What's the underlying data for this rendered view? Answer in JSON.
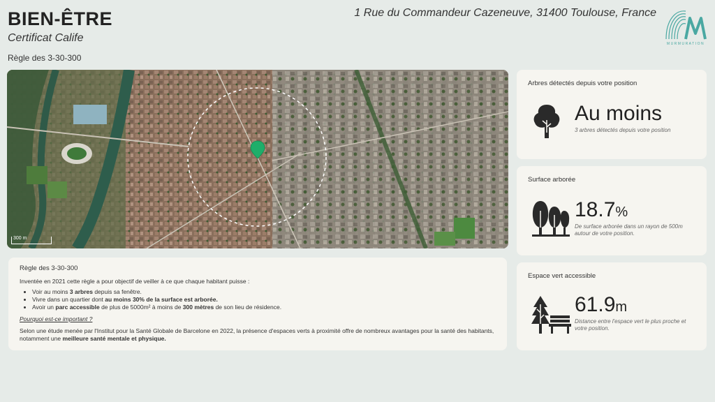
{
  "header": {
    "title": "BIEN-ÊTRE",
    "subtitle": "Certificat Calife",
    "section_label": "Règle des 3-30-300",
    "address": "1 Rue du Commandeur Cazeneuve, 31400 Toulouse, France",
    "logo_text": "MURMURATION"
  },
  "map": {
    "scale_label": "300 m",
    "accent_color": "#1fae6a"
  },
  "info": {
    "heading": "Règle des 3-30-300",
    "intro": "Inventée en 2021 cette règle a pour objectif de veiller à ce que chaque habitant puisse :",
    "bullets": [
      {
        "pre": "Voir au moins ",
        "bold": "3 arbres",
        "post": " depuis sa fenêtre.",
        "bold2": "",
        "post2": ""
      },
      {
        "pre": "Vivre dans un quartier dont ",
        "bold": "au moins 30% de la surface est arborée.",
        "post": "",
        "bold2": "",
        "post2": ""
      },
      {
        "pre": "Avoir un ",
        "bold": "parc accessible",
        "post": " de plus de 5000m² à moins de ",
        "bold2": "300 mètres",
        "post2": " de son lieu de résidence."
      }
    ],
    "why": "Pourquoi est-ce important ?",
    "conclusion_pre": "Selon une étude menée par l'Institut pour la Santé Globale de Barcelone en 2022, la présence d'espaces verts à proximité offre de nombreux avantages pour la santé des habitants, notamment une ",
    "conclusion_bold": "meilleure santé mentale et physique."
  },
  "cards": [
    {
      "label": "Arbres détectés depuis votre position",
      "value": "Au moins",
      "unit": "",
      "desc": "3 arbres détectés depuis votre position",
      "icon": "tree-icon"
    },
    {
      "label": "Surface arborée",
      "value": "18.7",
      "unit": "%",
      "desc": "De surface arborée dans un rayon de 500m autour de votre position.",
      "icon": "trees-icon"
    },
    {
      "label": "Espace vert accessible",
      "value": "61.9",
      "unit": "m",
      "desc": "Distance entre l'espace vert le plus proche et votre position.",
      "icon": "park-bench-icon"
    }
  ]
}
